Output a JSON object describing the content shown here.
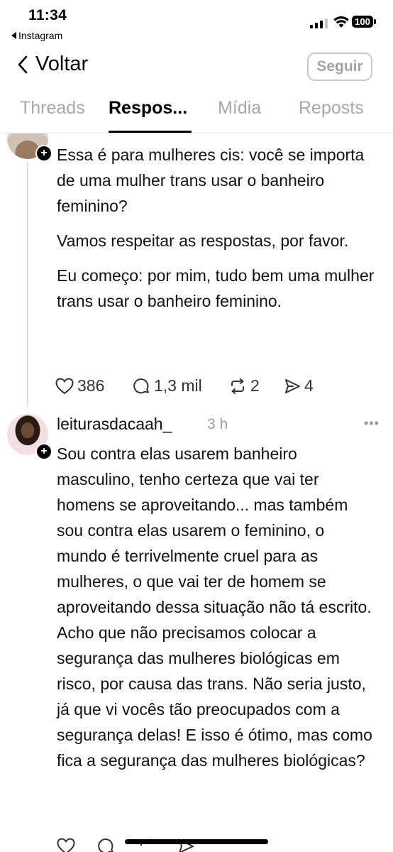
{
  "status_bar": {
    "time": "11:34",
    "back_app": "Instagram",
    "battery": "100"
  },
  "header": {
    "back_label": "Voltar",
    "follow_label": "Seguir"
  },
  "tabs": [
    {
      "label": "Threads",
      "active": false
    },
    {
      "label": "Respos...",
      "active": true
    },
    {
      "label": "Mídia",
      "active": false
    },
    {
      "label": "Reposts",
      "active": false
    }
  ],
  "post1": {
    "paragraphs": [
      "Essa é para mulheres cis: você se importa de uma mulher trans usar o banheiro feminino?",
      "Vamos respeitar as respostas, por favor.",
      "Eu começo: por mim, tudo bem uma mulher trans usar o banheiro feminino."
    ],
    "likes": "386",
    "replies": "1,3 mil",
    "reposts": "2",
    "shares": "4"
  },
  "post2": {
    "username": "leiturasdacaah_",
    "time": "3 h",
    "text": "Sou contra elas usarem banheiro masculino, tenho certeza que vai ter homens se aproveitando... mas também sou contra elas usarem o feminino, o mundo é terrivelmente cruel para as mulheres, o que vai ter de homem se aproveitando dessa situação não tá escrito. Acho que não precisamos colocar a segurança das mulheres biológicas em risco, por causa das trans. Não seria justo, já que vi vocês tão preocupados com a segurança delas! E isso é ótimo, mas como fica a segurança das mulheres biológicas?"
  },
  "more_icon": "•••",
  "colors": {
    "muted": "#a8a8a8",
    "thread_line": "#e0e0e0"
  }
}
